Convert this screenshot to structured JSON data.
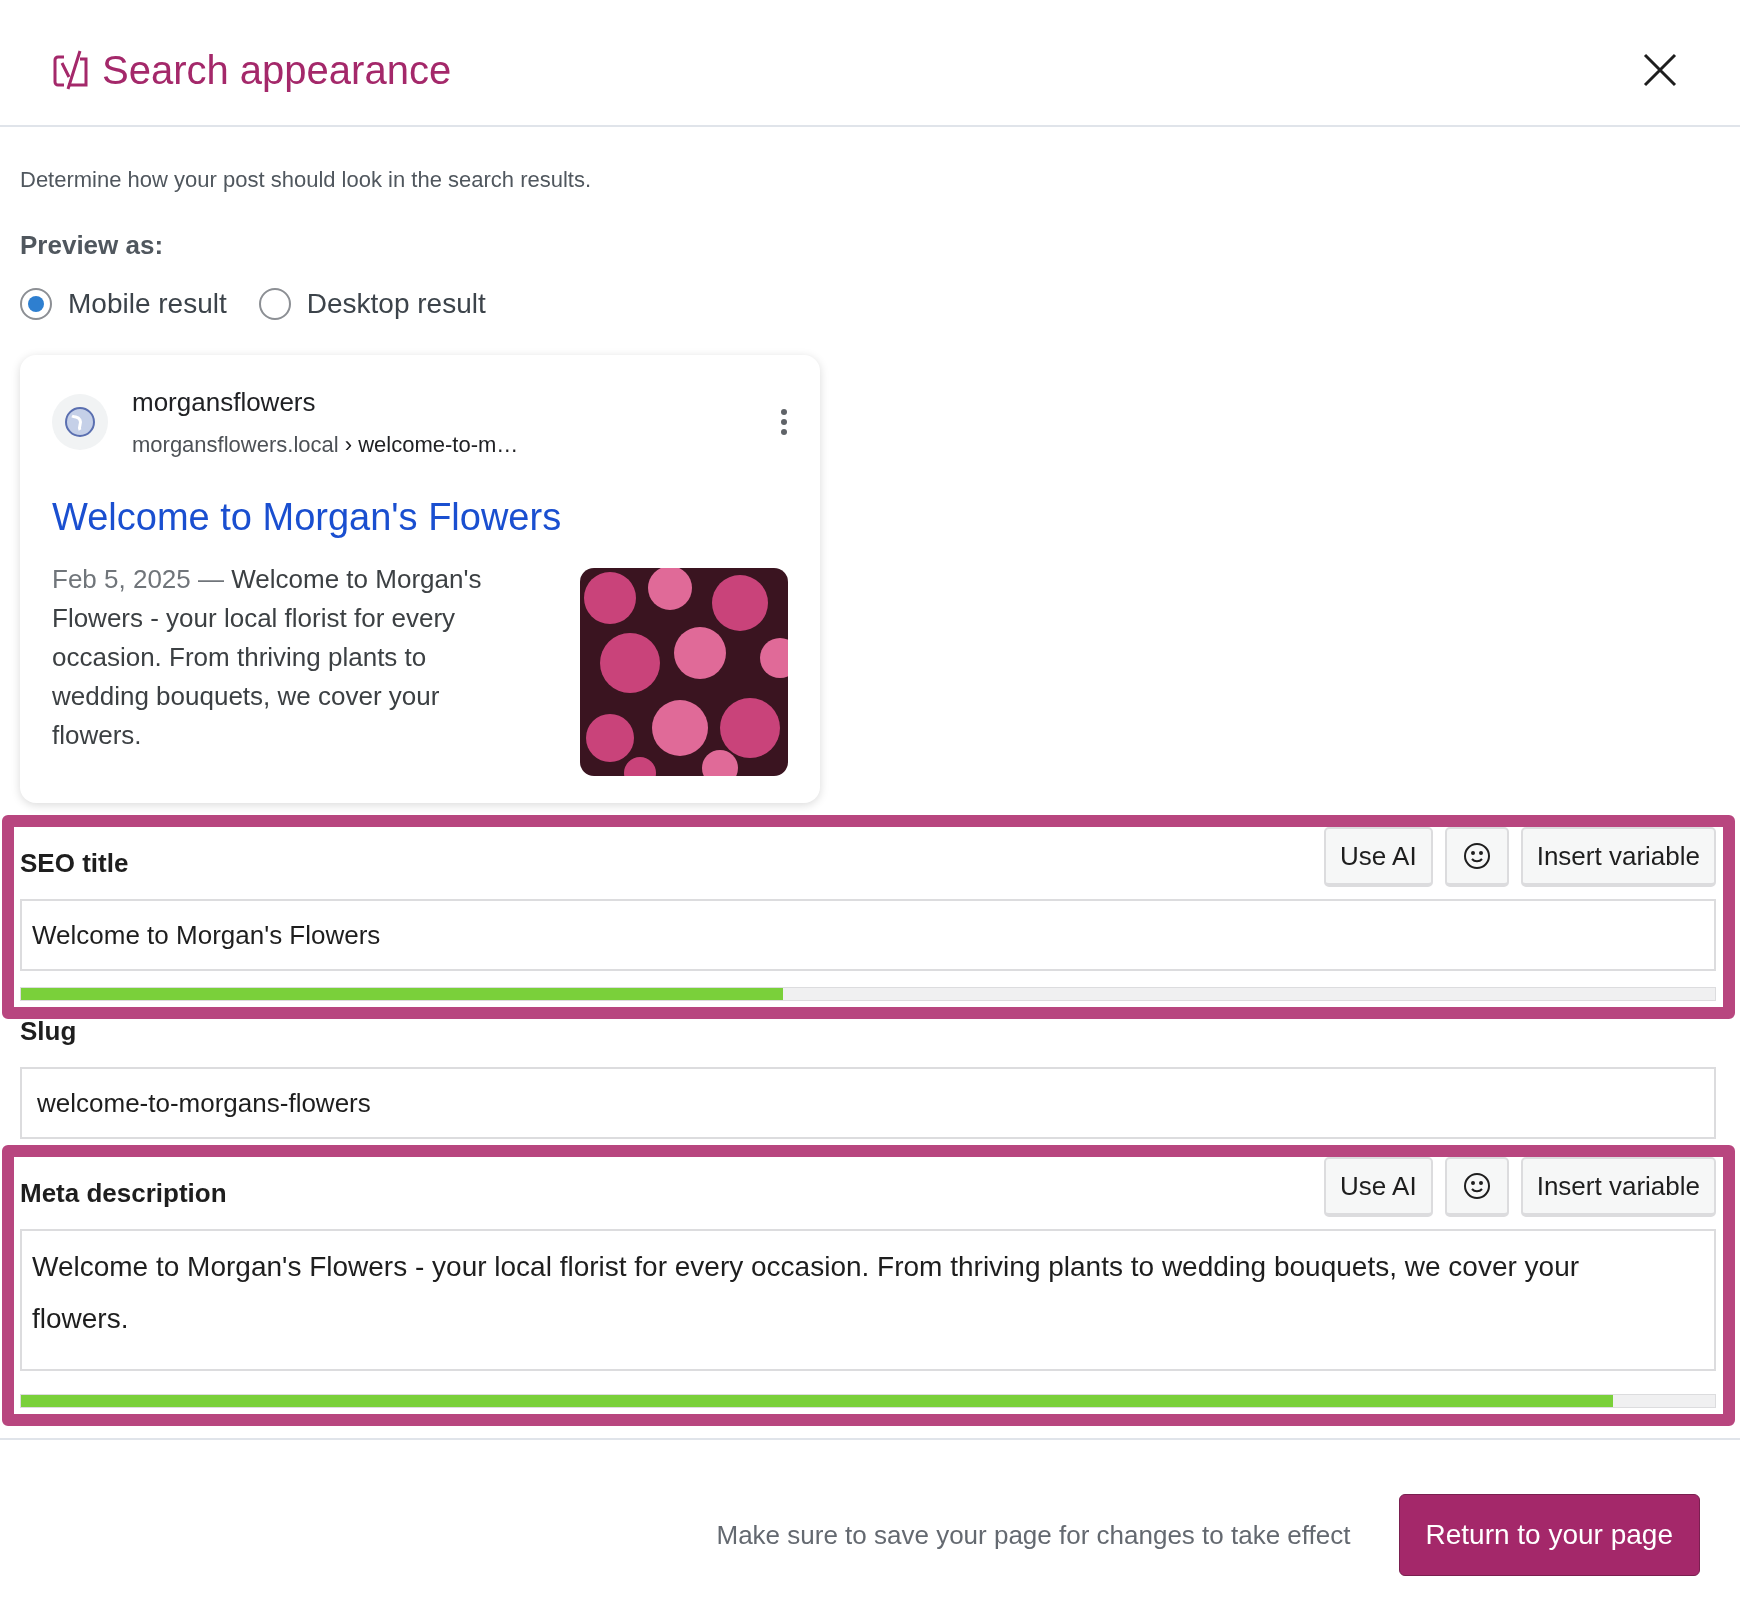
{
  "header": {
    "title": "Search appearance"
  },
  "intro": "Determine how your post should look in the search results.",
  "preview_label": "Preview as:",
  "preview_options": [
    {
      "label": "Mobile result",
      "selected": true
    },
    {
      "label": "Desktop result",
      "selected": false
    }
  ],
  "preview_card": {
    "site_name": "morgansflowers",
    "url_domain": "morgansflowers.local",
    "url_path": "› welcome-to-m…",
    "title": "Welcome to Morgan's Flowers",
    "date": "Feb 5, 2025",
    "separator": "—",
    "snippet": "Welcome to Morgan's Flowers - your local florist for every occasion. From thriving plants to wedding bouquets, we cover your flowers."
  },
  "fields": [
    {
      "kind": "input",
      "label": "SEO title",
      "value": "Welcome to Morgan's Flowers",
      "highlighted": true,
      "buttons": [
        {
          "kind": "text",
          "label": "Use AI"
        },
        {
          "kind": "emoji"
        },
        {
          "kind": "text",
          "label": "Insert variable"
        }
      ],
      "level": 0.45
    },
    {
      "kind": "input",
      "label": "Slug",
      "value": "welcome-to-morgans-flowers",
      "highlighted": false
    },
    {
      "kind": "textarea",
      "label": "Meta description",
      "value": "Welcome to Morgan's Flowers - your local florist for every occasion. From thriving plants to wedding bouquets, we cover your flowers.",
      "highlighted": true,
      "buttons": [
        {
          "kind": "text",
          "label": "Use AI"
        },
        {
          "kind": "emoji"
        },
        {
          "kind": "text",
          "label": "Insert variable"
        }
      ],
      "level": 0.94
    }
  ],
  "footer": {
    "note": "Make sure to save your page for changes to take effect",
    "button": "Return to your page"
  }
}
